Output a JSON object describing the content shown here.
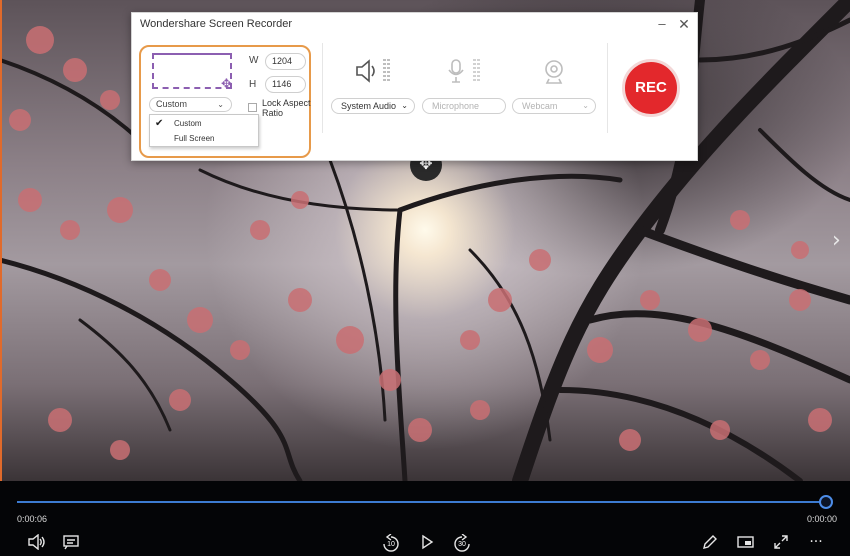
{
  "recorder": {
    "title": "Wondershare Screen Recorder",
    "width_label": "W",
    "width_value": "1204",
    "height_label": "H",
    "height_value": "1146",
    "mode_selected": "Custom",
    "lock_label": "Lock Aspect Ratio",
    "mode_options": [
      "Custom",
      "Full Screen"
    ],
    "system_audio": "System Audio",
    "microphone": "Microphone",
    "webcam": "Webcam",
    "rec_label": "REC",
    "colors": {
      "region_outline": "#e79a4a",
      "region_preview": "#8c5fb1",
      "rec": "#e3282c"
    }
  },
  "player": {
    "elapsed": "0:00:06",
    "remaining": "0:00:00",
    "skip_back": "10",
    "skip_forward": "30",
    "progress": 1.0,
    "accent": "#3c7bd1"
  },
  "icons": {
    "volume": "volume-icon",
    "captions": "captions-icon",
    "play": "play-icon",
    "edit": "pencil-icon",
    "pip": "picture-in-picture-icon",
    "fullscreen": "fullscreen-icon",
    "more": "more-icon",
    "next": "chevron-right-icon",
    "move": "move-icon"
  }
}
